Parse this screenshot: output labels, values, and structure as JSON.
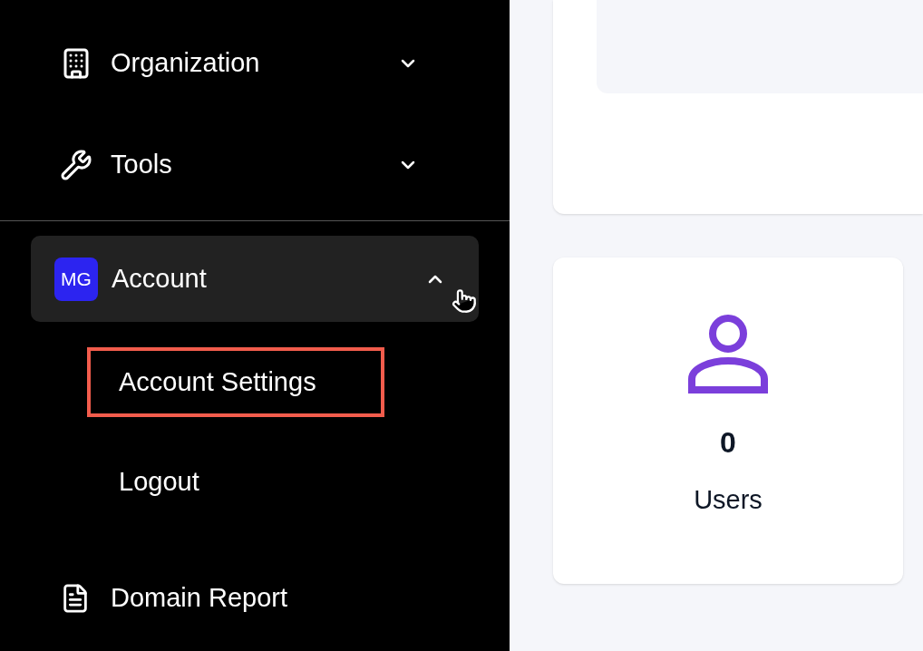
{
  "sidebar": {
    "items": [
      {
        "kind": "group",
        "label": "Organization",
        "expanded": false
      },
      {
        "kind": "group",
        "label": "Tools",
        "expanded": false
      },
      {
        "kind": "account",
        "avatar": "MG",
        "label": "Account",
        "expanded": true,
        "children": [
          {
            "label": "Account Settings",
            "highlighted": true
          },
          {
            "label": "Logout",
            "highlighted": false
          }
        ]
      },
      {
        "kind": "link",
        "label": "Domain Report"
      }
    ]
  },
  "stats": [
    {
      "value": "0",
      "label": "Users"
    }
  ]
}
